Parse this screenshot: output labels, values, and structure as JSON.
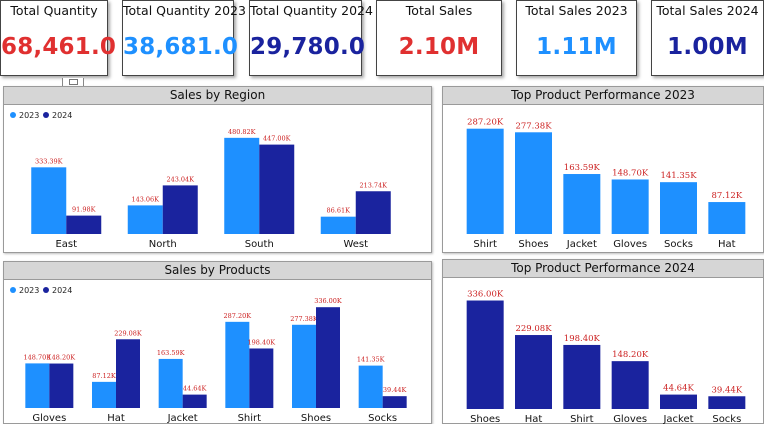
{
  "colors": {
    "series_2023": "#1e90ff",
    "series_2024": "#1a239e",
    "value_label": "#cc2222",
    "quantity_total": "#e03030",
    "year_2023": "#1e90ff",
    "year_2024": "#1a239e",
    "sales_total": "#e03030"
  },
  "kpis": [
    {
      "title": "Total Quantity",
      "value": "68,461.0",
      "color_key": "quantity_total"
    },
    {
      "title": "Total Quantity 2023",
      "value": "38,681.0",
      "color_key": "year_2023"
    },
    {
      "title": "Total Quantity 2024",
      "value": "29,780.0",
      "color_key": "year_2024"
    },
    {
      "title": "Total Sales",
      "value": "2.10M",
      "color_key": "sales_total"
    },
    {
      "title": "Total Sales 2023",
      "value": "1.11M",
      "color_key": "year_2023"
    },
    {
      "title": "Total Sales 2024",
      "value": "1.00M",
      "color_key": "year_2024"
    }
  ],
  "chart_data": [
    {
      "id": "region",
      "title": "Sales by Region",
      "type": "bar",
      "legend": "top-left",
      "categories": [
        "East",
        "North",
        "South",
        "West"
      ],
      "series": [
        {
          "name": "2023",
          "values": [
            333.39,
            143.06,
            480.82,
            86.61
          ],
          "labels": [
            "333.39K",
            "143.06K",
            "480.82K",
            "86.61K"
          ]
        },
        {
          "name": "2024",
          "values": [
            91.98,
            243.04,
            447.0,
            213.74
          ],
          "labels": [
            "91.98K",
            "243.04K",
            "447.00K",
            "213.74K"
          ]
        }
      ],
      "ylim": [
        0,
        500
      ]
    },
    {
      "id": "top2023",
      "title": "Top Product Performance 2023",
      "type": "bar",
      "categories": [
        "Shirt",
        "Shoes",
        "Jacket",
        "Gloves",
        "Socks",
        "Hat"
      ],
      "series": [
        {
          "values": [
            287.2,
            277.38,
            163.59,
            148.7,
            141.35,
            87.12
          ],
          "labels": [
            "287.20K",
            "277.38K",
            "163.59K",
            "148.70K",
            "141.35K",
            "87.12K"
          ]
        }
      ],
      "ylim": [
        0,
        300
      ]
    },
    {
      "id": "products",
      "title": "Sales by Products",
      "type": "bar",
      "legend": "top-left",
      "categories": [
        "Gloves",
        "Hat",
        "Jacket",
        "Shirt",
        "Shoes",
        "Socks"
      ],
      "series": [
        {
          "name": "2023",
          "values": [
            148.7,
            87.12,
            163.59,
            287.2,
            277.38,
            141.35
          ],
          "labels": [
            "148.70K",
            "87.12K",
            "163.59K",
            "287.20K",
            "277.38K",
            "141.35K"
          ]
        },
        {
          "name": "2024",
          "values": [
            148.2,
            229.08,
            44.64,
            198.4,
            336.0,
            39.44
          ],
          "labels": [
            "148.20K",
            "229.08K",
            "44.64K",
            "198.40K",
            "336.00K",
            "39.44K"
          ]
        }
      ],
      "ylim": [
        0,
        350
      ]
    },
    {
      "id": "top2024",
      "title": "Top Product Performance 2024",
      "type": "bar",
      "categories": [
        "Shoes",
        "Hat",
        "Shirt",
        "Gloves",
        "Jacket",
        "Socks"
      ],
      "series": [
        {
          "values": [
            336.0,
            229.08,
            198.4,
            148.2,
            44.64,
            39.44
          ],
          "labels": [
            "336.00K",
            "229.08K",
            "198.40K",
            "148.20K",
            "44.64K",
            "39.44K"
          ]
        }
      ],
      "ylim": [
        0,
        350
      ]
    }
  ]
}
